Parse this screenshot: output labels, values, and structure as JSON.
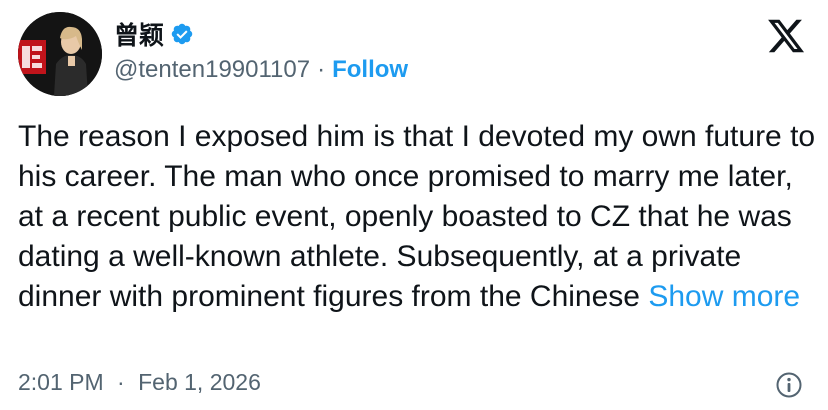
{
  "author": {
    "display_name": "曾颖",
    "handle": "@tenten19901107",
    "separator": "·",
    "follow_label": "Follow"
  },
  "tweet": {
    "text": "The reason I exposed him is that I devoted my own future to his career. The man who once promised to marry me later, at a recent public event, openly boasted to CZ that he was dating a well-known athlete. Subsequently, at a private dinner with prominent figures from the Chinese",
    "show_more_label": "Show more",
    "time": "2:01 PM",
    "separator": "·",
    "date": "Feb 1, 2026"
  },
  "colors": {
    "accent": "#1d9bf0",
    "text_primary": "#0f1419",
    "text_secondary": "#536471"
  },
  "icons": {
    "verified": "verified-badge-icon",
    "brand": "x-logo-icon",
    "info": "info-icon"
  }
}
